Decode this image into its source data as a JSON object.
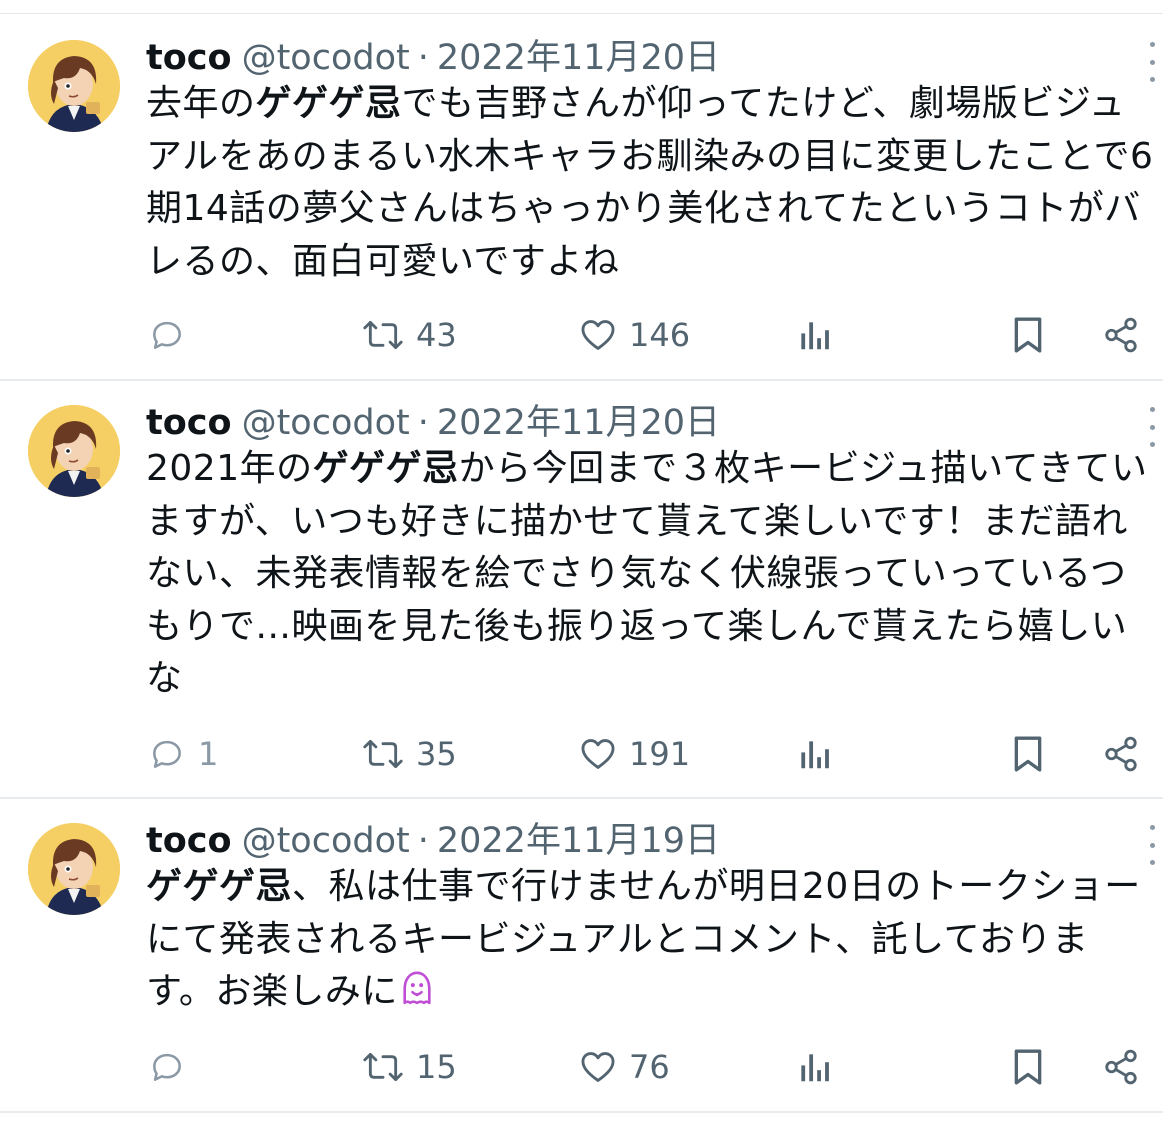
{
  "tweets": [
    {
      "name": "toco",
      "handle": "@tocodot",
      "separator": "·",
      "date": "2022年11月20日",
      "text_bold": "ゲゲゲ忌",
      "text_before": "去年の",
      "text_after": "でも吉野さんが仰ってたけど、劇場版ビジュアルをあのまるい水木キャラお馴染みの目に変更したことで6期14話の夢父さんはちゃっかり美化されてたというコトがバレるの、面白可愛いですよね",
      "replies": "",
      "retweets": "43",
      "likes": "146"
    },
    {
      "name": "toco",
      "handle": "@tocodot",
      "separator": "·",
      "date": "2022年11月20日",
      "text_before": "2021年の",
      "text_bold": "ゲゲゲ忌",
      "text_after": "から今回まで３枚キービジュ描いてきていますが、いつも好きに描かせて貰えて楽しいです！まだ語れない、未発表情報を絵でさり気なく伏線張っていっているつもりで...映画を見た後も振り返って楽しんで貰えたら嬉しいな",
      "replies": "1",
      "retweets": "35",
      "likes": "191"
    },
    {
      "name": "toco",
      "handle": "@tocodot",
      "separator": "·",
      "date": "2022年11月19日",
      "text_before": "",
      "text_bold": "ゲゲゲ忌",
      "text_after": "、私は仕事で行けませんが明日20日のトークショーにて発表されるキービジュアルとコメント、託しております。お楽しみに",
      "emoji": "ghost-emoji",
      "replies": "",
      "retweets": "15",
      "likes": "76"
    }
  ],
  "icons": {
    "reply": "reply-icon",
    "retweet": "retweet-icon",
    "like": "heart-icon",
    "views": "analytics-icon",
    "bookmark": "bookmark-icon",
    "share": "share-icon",
    "more": "more-vertical-icon"
  },
  "colors": {
    "text": "#0f1419",
    "secondary": "#536471",
    "divider": "#e9ecef",
    "avatar_bg": "#f5cf64",
    "ghost": "#c04fd6"
  }
}
